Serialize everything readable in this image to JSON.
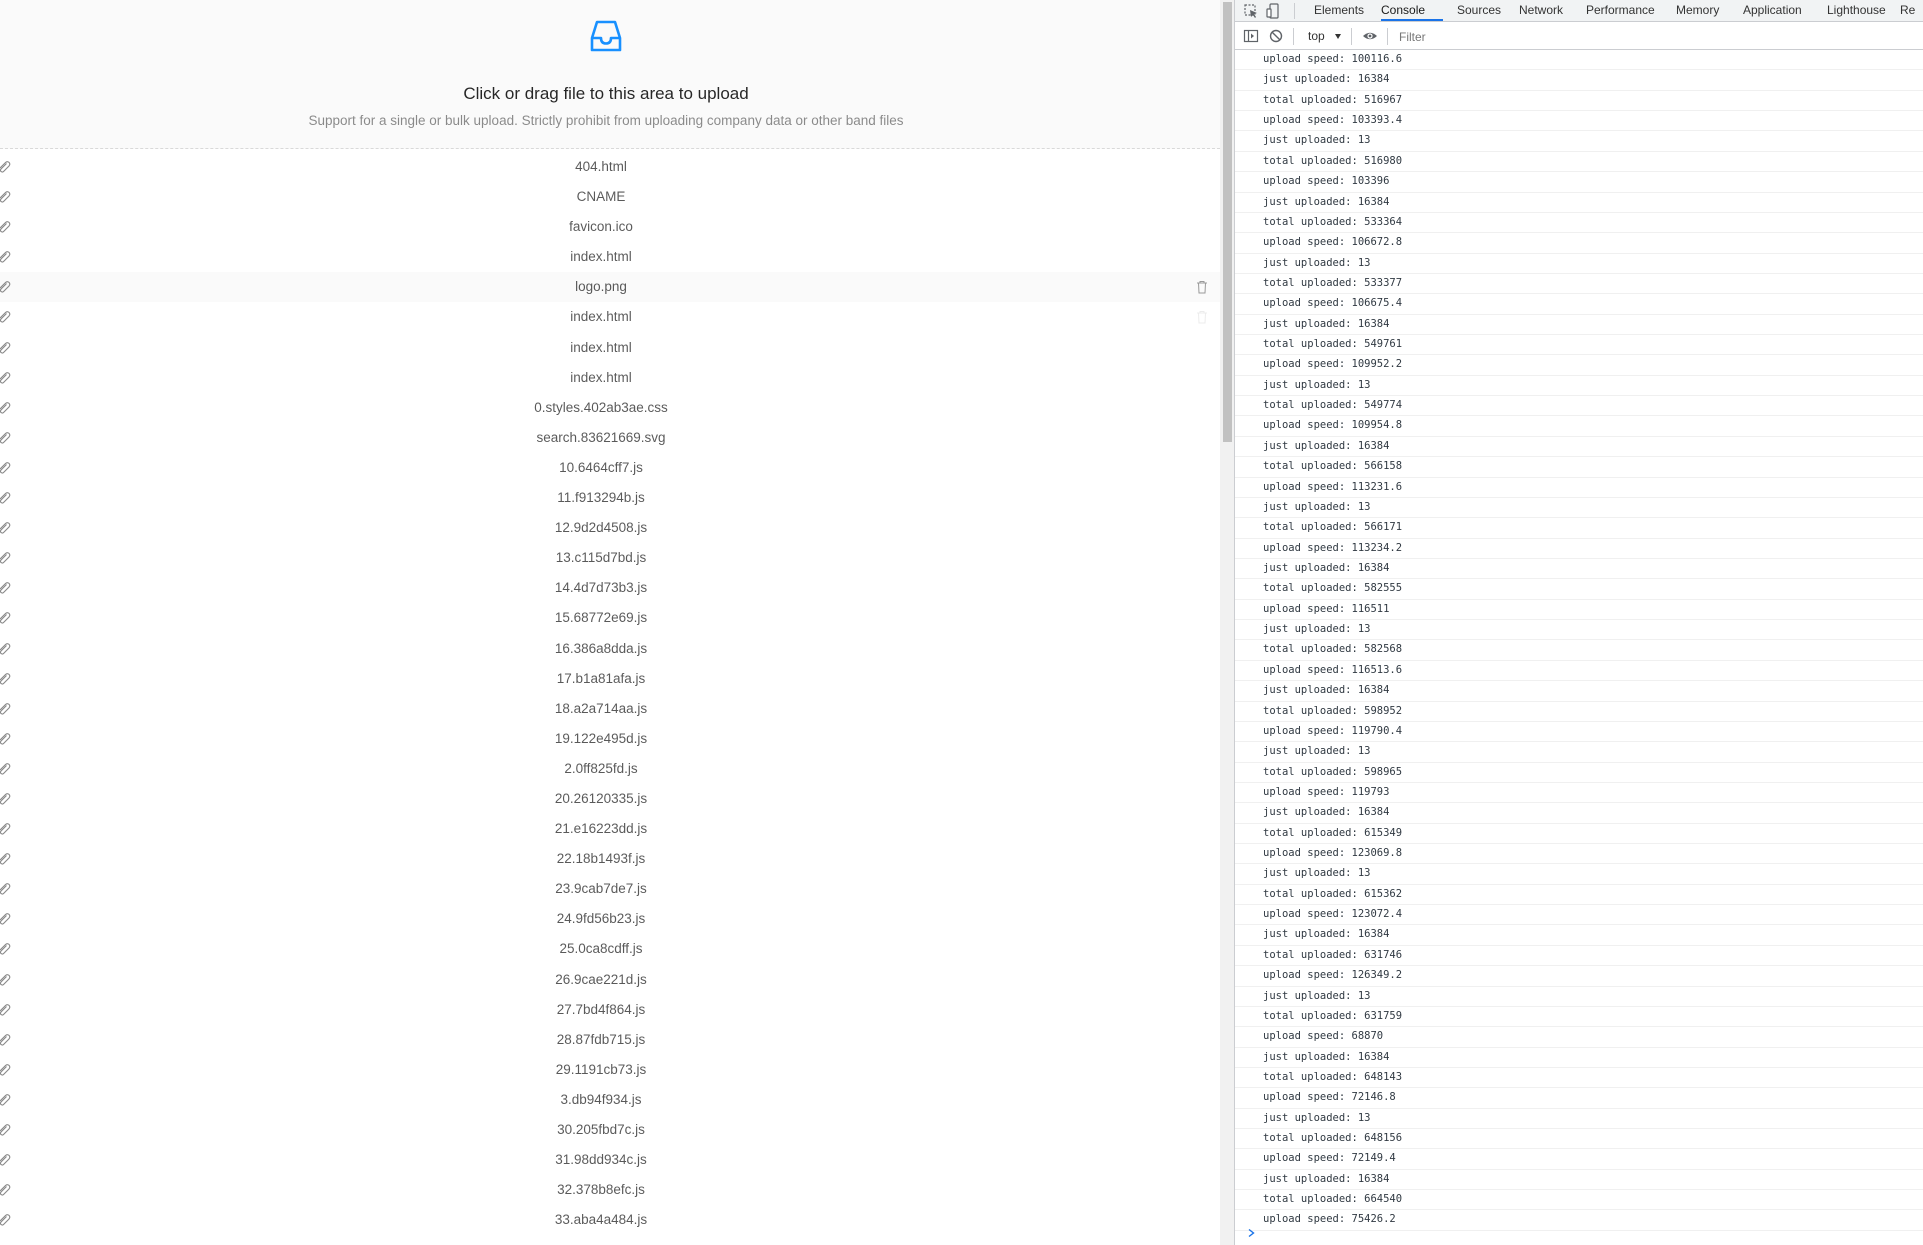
{
  "upload": {
    "title": "Click or drag file to this area to upload",
    "hint": "Support for a single or bulk upload. Strictly prohibit from uploading company data or other band files",
    "files": [
      "404.html",
      "CNAME",
      "favicon.ico",
      "index.html",
      "logo.png",
      "index.html",
      "index.html",
      "index.html",
      "0.styles.402ab3ae.css",
      "search.83621669.svg",
      "10.6464cff7.js",
      "11.f913294b.js",
      "12.9d2d4508.js",
      "13.c115d7bd.js",
      "14.4d7d73b3.js",
      "15.68772e69.js",
      "16.386a8dda.js",
      "17.b1a81afa.js",
      "18.a2a714aa.js",
      "19.122e495d.js",
      "2.0ff825fd.js",
      "20.26120335.js",
      "21.e16223dd.js",
      "22.18b1493f.js",
      "23.9cab7de7.js",
      "24.9fd56b23.js",
      "25.0ca8cdff.js",
      "26.9cae221d.js",
      "27.7bd4f864.js",
      "28.87fdb715.js",
      "29.1191cb73.js",
      "3.db94f934.js",
      "30.205fbd7c.js",
      "31.98dd934c.js",
      "32.378b8efc.js",
      "33.aba4a484.js"
    ],
    "hovered_index": 4
  },
  "devtools": {
    "tabs": [
      "Elements",
      "Console",
      "Sources",
      "Network",
      "Performance",
      "Memory",
      "Application",
      "Lighthouse",
      "Re"
    ],
    "active_tab": "Console",
    "context": "top",
    "filter_placeholder": "Filter",
    "console_lines": [
      "upload speed: 100116.6",
      "just uploaded: 16384",
      "total uploaded: 516967",
      "upload speed: 103393.4",
      "just uploaded: 13",
      "total uploaded: 516980",
      "upload speed: 103396",
      "just uploaded: 16384",
      "total uploaded: 533364",
      "upload speed: 106672.8",
      "just uploaded: 13",
      "total uploaded: 533377",
      "upload speed: 106675.4",
      "just uploaded: 16384",
      "total uploaded: 549761",
      "upload speed: 109952.2",
      "just uploaded: 13",
      "total uploaded: 549774",
      "upload speed: 109954.8",
      "just uploaded: 16384",
      "total uploaded: 566158",
      "upload speed: 113231.6",
      "just uploaded: 13",
      "total uploaded: 566171",
      "upload speed: 113234.2",
      "just uploaded: 16384",
      "total uploaded: 582555",
      "upload speed: 116511",
      "just uploaded: 13",
      "total uploaded: 582568",
      "upload speed: 116513.6",
      "just uploaded: 16384",
      "total uploaded: 598952",
      "upload speed: 119790.4",
      "just uploaded: 13",
      "total uploaded: 598965",
      "upload speed: 119793",
      "just uploaded: 16384",
      "total uploaded: 615349",
      "upload speed: 123069.8",
      "just uploaded: 13",
      "total uploaded: 615362",
      "upload speed: 123072.4",
      "just uploaded: 16384",
      "total uploaded: 631746",
      "upload speed: 126349.2",
      "just uploaded: 13",
      "total uploaded: 631759",
      "upload speed: 68870",
      "just uploaded: 16384",
      "total uploaded: 648143",
      "upload speed: 72146.8",
      "just uploaded: 13",
      "total uploaded: 648156",
      "upload speed: 72149.4",
      "just uploaded: 16384",
      "total uploaded: 664540",
      "upload speed: 75426.2"
    ]
  },
  "colors": {
    "primary": "#1890ff",
    "devtools_accent": "#1a73e8"
  }
}
